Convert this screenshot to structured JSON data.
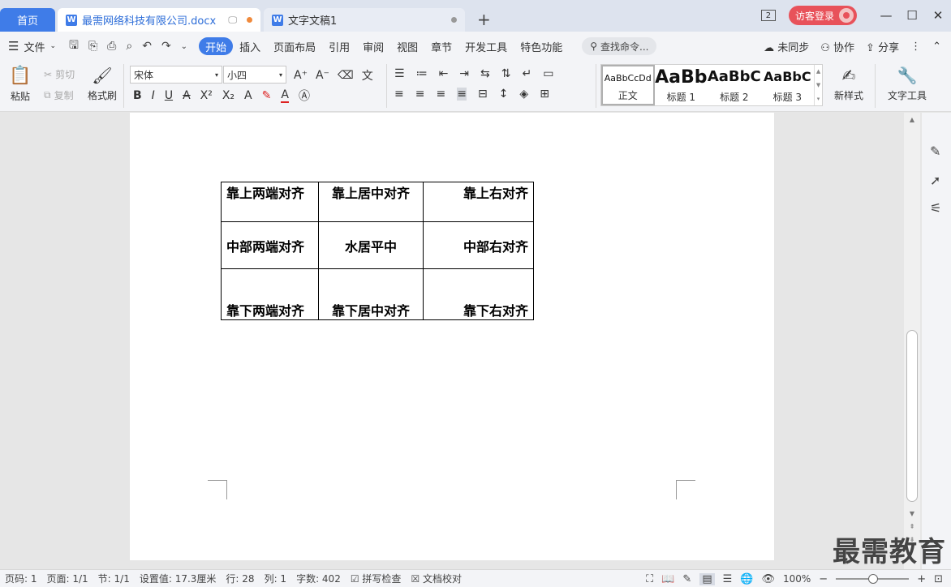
{
  "tabs": {
    "home": "首页",
    "active_doc": "最需网络科技有限公司.docx",
    "inactive_doc": "文字文稿1",
    "new_tab": "+"
  },
  "window": {
    "badge": "2",
    "login": "访客登录",
    "minimize": "—",
    "maximize": "☐",
    "close": "✕"
  },
  "menu": {
    "file": "文件",
    "tabs": [
      "开始",
      "插入",
      "页面布局",
      "引用",
      "审阅",
      "视图",
      "章节",
      "开发工具",
      "特色功能"
    ],
    "search": "查找命令...",
    "sync": "未同步",
    "collab": "协作",
    "share": "分享"
  },
  "ribbon": {
    "paste": "粘贴",
    "cut": "剪切",
    "copy": "复制",
    "format_painter": "格式刷",
    "font_name": "宋体",
    "font_size": "小四",
    "styles": [
      {
        "preview": "AaBbCcDd",
        "name": "正文"
      },
      {
        "preview": "AaBb",
        "name": "标题 1"
      },
      {
        "preview": "AaBbC",
        "name": "标题 2"
      },
      {
        "preview": "AaBbC",
        "name": "标题 3"
      }
    ],
    "new_style": "新样式",
    "text_tools": "文字工具"
  },
  "table": {
    "rows": [
      [
        "靠上两端对齐",
        "靠上居中对齐",
        "靠上右对齐"
      ],
      [
        "中部两端对齐",
        "水居平中",
        "中部右对齐"
      ],
      [
        "靠下两端对齐",
        "靠下居中对齐",
        "靠下右对齐"
      ]
    ]
  },
  "status": {
    "page_num": "页码: 1",
    "pages": "页面: 1/1",
    "section": "节: 1/1",
    "setting": "设置值: 17.3厘米",
    "row": "行: 28",
    "col": "列: 1",
    "words": "字数: 402",
    "spell": "拼写检查",
    "proof": "文档校对",
    "zoom": "100%"
  },
  "watermark": "最需教育"
}
